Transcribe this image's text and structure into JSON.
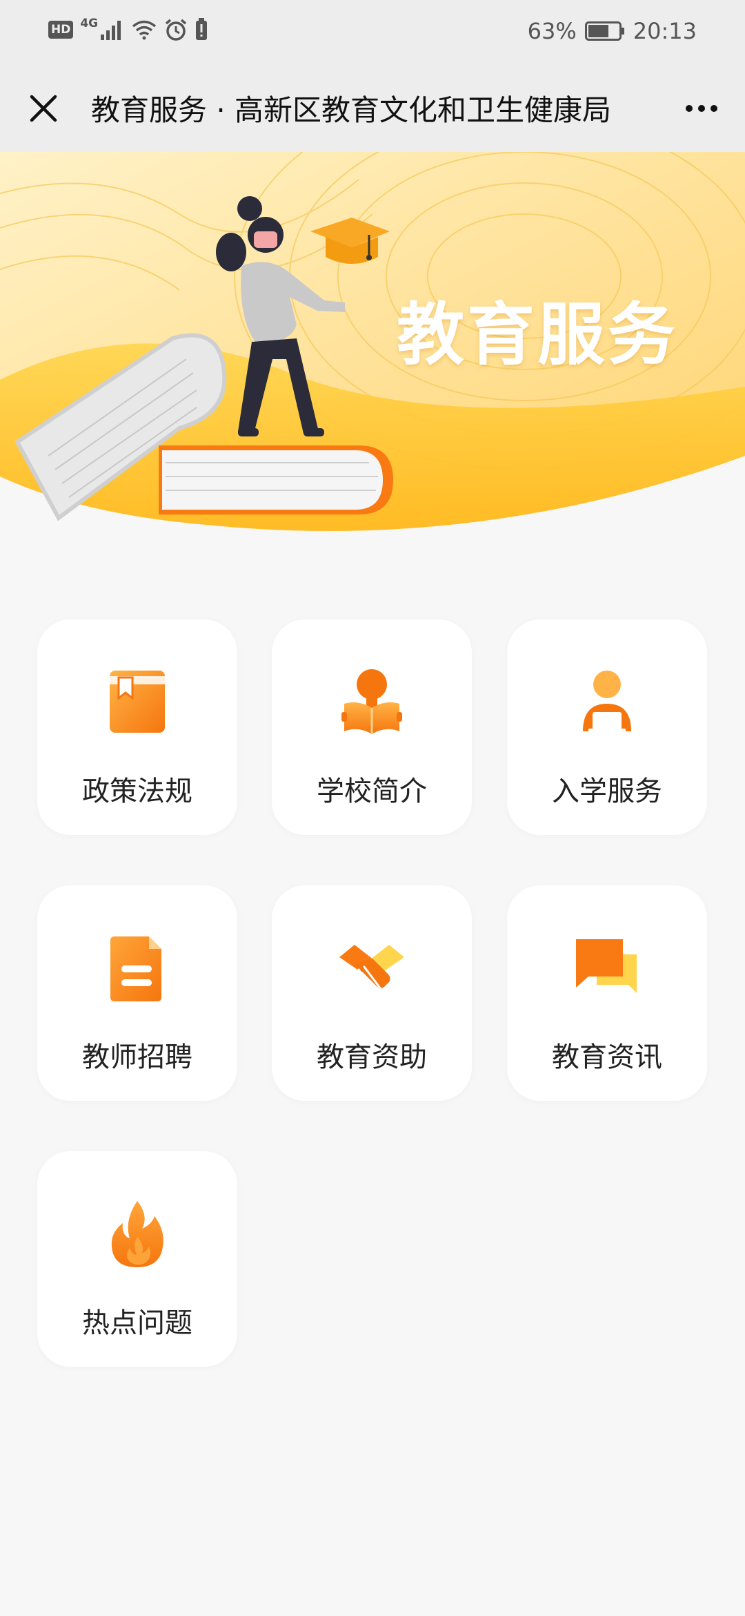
{
  "status_bar": {
    "hd_badge": "HD",
    "network": "4G",
    "battery": "63%",
    "time": "20:13",
    "icons": [
      "hd-icon",
      "signal-icon",
      "wifi-icon",
      "alarm-icon",
      "alert-icon",
      "battery-icon"
    ]
  },
  "titlebar": {
    "title": "教育服务 · 高新区教育文化和卫生健康局",
    "close_icon": "close-icon",
    "more_icon": "more-icon"
  },
  "banner": {
    "title": "教育服务"
  },
  "services": [
    {
      "label": "政策法规",
      "icon": "book-icon"
    },
    {
      "label": "学校简介",
      "icon": "reading-person-icon"
    },
    {
      "label": "入学服务",
      "icon": "user-laptop-icon"
    },
    {
      "label": "教师招聘",
      "icon": "document-icon"
    },
    {
      "label": "教育资助",
      "icon": "handshake-icon"
    },
    {
      "label": "教育资讯",
      "icon": "chat-icon"
    },
    {
      "label": "热点问题",
      "icon": "fire-icon"
    }
  ],
  "colors": {
    "accent_orange": "#f97a12",
    "accent_light": "#ffb347",
    "accent_yellow": "#ffd84a",
    "banner_bg": "#ffe9a8"
  }
}
